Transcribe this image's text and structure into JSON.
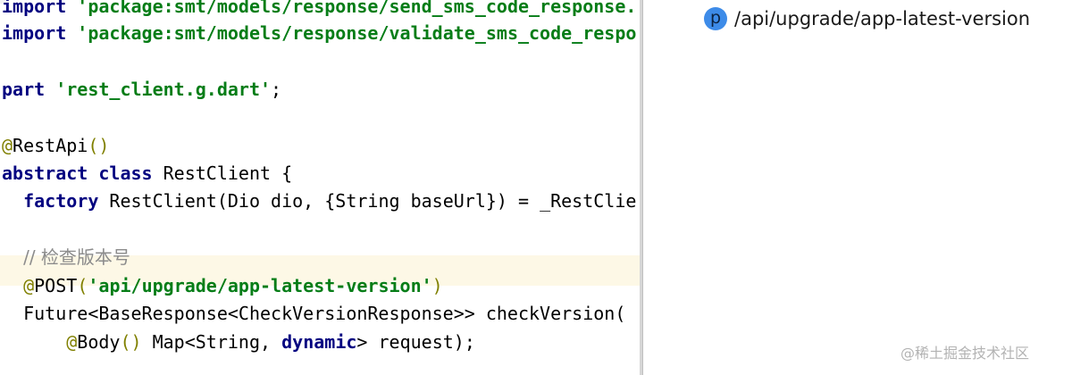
{
  "editor": {
    "lines": [
      {
        "parts": [
          {
            "kind": "kw",
            "text": "import "
          },
          {
            "kind": "str",
            "text": "'package:smt/models/response/send_sms_code_response."
          }
        ]
      },
      {
        "parts": [
          {
            "kind": "kw",
            "text": "import "
          },
          {
            "kind": "str",
            "text": "'package:smt/models/response/validate_sms_code_respo"
          }
        ]
      },
      {
        "parts": []
      },
      {
        "parts": [
          {
            "kind": "kw",
            "text": "part "
          },
          {
            "kind": "str",
            "text": "'rest_client.g.dart'"
          },
          {
            "kind": "plain",
            "text": ";"
          }
        ]
      },
      {
        "parts": []
      },
      {
        "parts": [
          {
            "kind": "ann",
            "text": "@"
          },
          {
            "kind": "plain",
            "text": "RestApi"
          },
          {
            "kind": "ann",
            "text": "()"
          }
        ]
      },
      {
        "parts": [
          {
            "kind": "kw",
            "text": "abstract class "
          },
          {
            "kind": "plain",
            "text": "RestClient {"
          }
        ]
      },
      {
        "parts": [
          {
            "kind": "plain",
            "text": "  "
          },
          {
            "kind": "kw",
            "text": "factory "
          },
          {
            "kind": "plain",
            "text": "RestClient(Dio dio, {String baseUrl}) = _RestClie"
          }
        ]
      },
      {
        "parts": []
      },
      {
        "parts": [
          {
            "kind": "plain",
            "text": "  "
          },
          {
            "kind": "cmt",
            "text": "// 检查版本号"
          }
        ]
      },
      {
        "parts": [
          {
            "kind": "plain",
            "text": "  "
          },
          {
            "kind": "ann",
            "text": "@"
          },
          {
            "kind": "plain",
            "text": "POST"
          },
          {
            "kind": "ann",
            "text": "("
          },
          {
            "kind": "str",
            "text": "'api/upgrade/app-latest-version'"
          },
          {
            "kind": "ann",
            "text": ")"
          }
        ]
      },
      {
        "parts": [
          {
            "kind": "plain",
            "text": "  Future<BaseResponse<CheckVersionResponse>> checkVersion("
          }
        ]
      },
      {
        "parts": [
          {
            "kind": "plain",
            "text": "      "
          },
          {
            "kind": "ann",
            "text": "@"
          },
          {
            "kind": "plain",
            "text": "Body"
          },
          {
            "kind": "ann",
            "text": "()"
          },
          {
            "kind": "plain",
            "text": " Map<String, "
          },
          {
            "kind": "kw",
            "text": "dynamic"
          },
          {
            "kind": "plain",
            "text": "> request);"
          }
        ]
      }
    ]
  },
  "endpoints": {
    "items": [
      {
        "icon": "p-icon",
        "icon_letter": "p",
        "path": "/api/upgrade/app-latest-version"
      }
    ]
  },
  "watermark": "@稀土掘金技术社区"
}
